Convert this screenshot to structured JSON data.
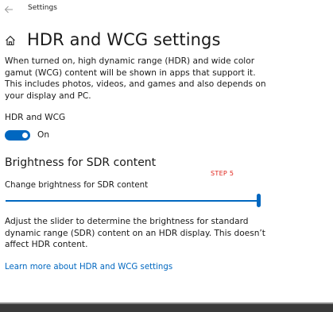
{
  "window": {
    "title": "Settings"
  },
  "header": {
    "title": "HDR and WCG settings"
  },
  "intro": "When turned on, high dynamic range (HDR) and wide color gamut (WCG) content will be shown in apps that support it. This includes photos, videos, and games and also depends on your display and PC.",
  "hdr_toggle": {
    "label": "HDR and WCG",
    "state_label": "On",
    "on": true
  },
  "brightness": {
    "section_title": "Brightness for SDR content",
    "annotation": "STEP 5",
    "slider_label": "Change brightness for SDR content",
    "slider_value": 1.0,
    "description": "Adjust the slider to determine the brightness for standard dynamic range (SDR) content on an HDR display. This doesn’t affect HDR content."
  },
  "links": {
    "learn_more": "Learn more about HDR and WCG settings"
  },
  "colors": {
    "accent": "#0067c0",
    "annotation": "#e0241b",
    "taskbar": "#3a3a3a"
  },
  "icons": {
    "back": "back-arrow-icon",
    "home": "home-icon"
  }
}
